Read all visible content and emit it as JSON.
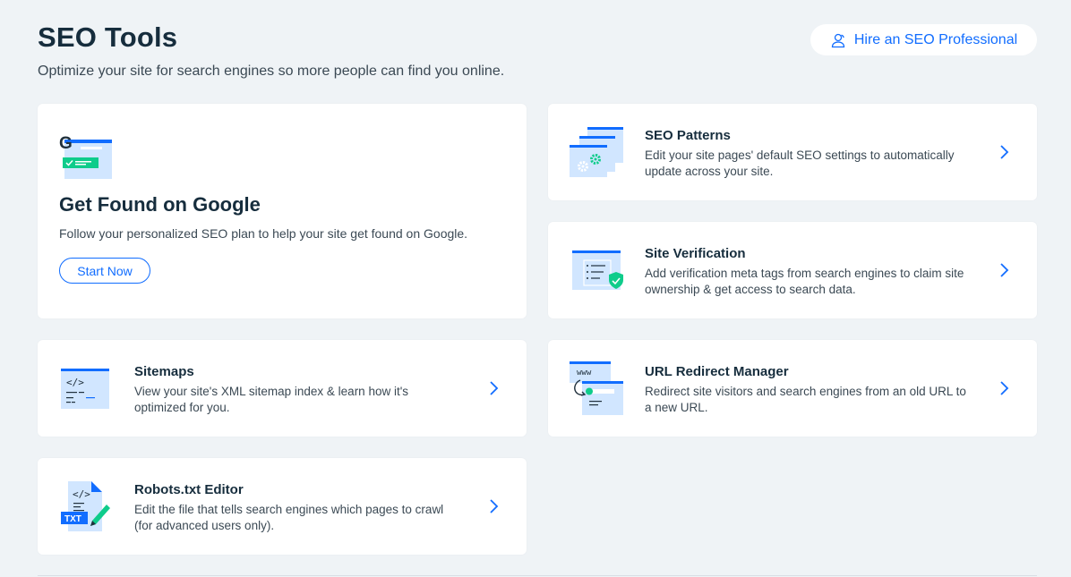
{
  "header": {
    "title": "SEO Tools",
    "subtitle": "Optimize your site for search engines so more people can find you online.",
    "hire_label": "Hire an SEO Professional"
  },
  "google_card": {
    "heading": "Get Found on Google",
    "description": "Follow your personalized SEO plan to help your site get found on Google.",
    "button_label": "Start Now",
    "logo_letter": "G"
  },
  "tools": [
    {
      "title": "SEO Patterns",
      "description": "Edit your site pages' default SEO settings to automatically update across your site."
    },
    {
      "title": "Site Verification",
      "description": "Add verification meta tags from search engines to claim site ownership & get access to search data."
    },
    {
      "title": "Sitemaps",
      "description": "View your site's XML sitemap index & learn how it's optimized for you.",
      "code_glyph": "</>"
    },
    {
      "title": "URL Redirect Manager",
      "description": "Redirect site visitors and search engines from an old URL to a new URL.",
      "www_label": "www"
    },
    {
      "title": "Robots.txt Editor",
      "description": "Edit the file that tells search engines which pages to crawl (for advanced users only).",
      "code_glyph": "</>",
      "file_label": "TXT"
    }
  ],
  "colors": {
    "accent": "#116dff",
    "green": "#0fcc8b",
    "light_blue": "#d1e6ff",
    "background": "#eff3f6",
    "heading": "#162d3d"
  }
}
